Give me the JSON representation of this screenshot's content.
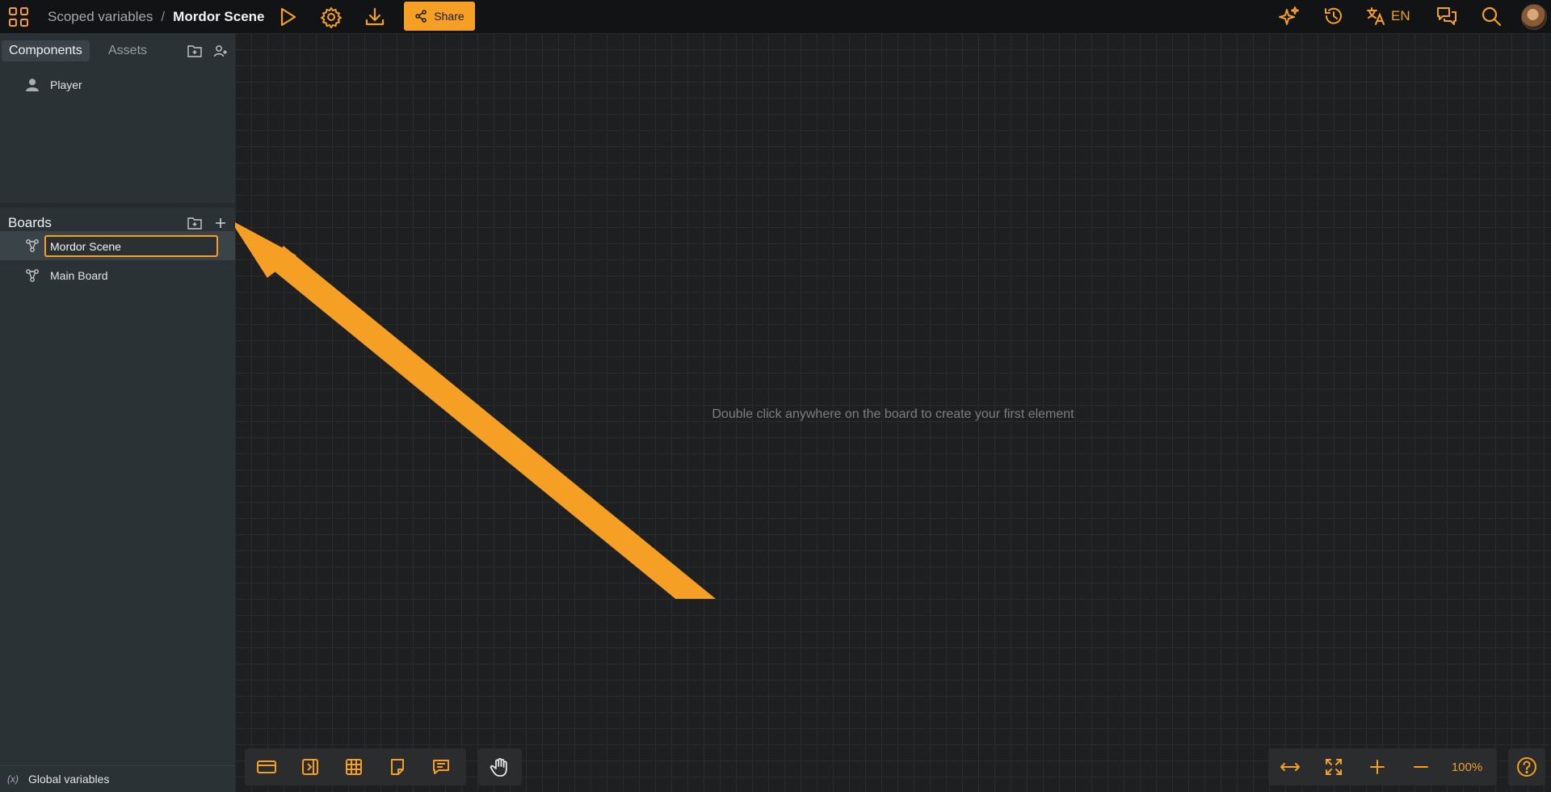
{
  "colors": {
    "accent": "#f5a024",
    "sidebar_bg": "#2b3235",
    "canvas_bg": "#1e1f20",
    "topbar_bg": "#121314"
  },
  "topbar": {
    "project_name": "Scoped variables",
    "separator": "/",
    "current_board": "Mordor Scene",
    "share_label": "Share",
    "language": "EN",
    "icons": [
      "apps-grid-icon",
      "play-icon",
      "gear-icon",
      "download-icon",
      "share-icon",
      "sparkles-icon",
      "history-icon",
      "translate-icon",
      "comments-icon",
      "search-icon",
      "avatar"
    ]
  },
  "sidebar": {
    "tabs": {
      "components": "Components",
      "assets": "Assets"
    },
    "components": [
      {
        "label": "Player",
        "icon": "user-icon"
      }
    ],
    "boards_title": "Boards",
    "boards": [
      {
        "label": "Mordor Scene",
        "icon": "board-graph-icon",
        "editing": true
      },
      {
        "label": "Main Board",
        "icon": "board-graph-icon"
      }
    ],
    "global_variables_icon": "(x)",
    "global_variables_label": "Global variables"
  },
  "canvas": {
    "empty_hint": "Double click anywhere on the board to create your first element",
    "zoom": "100%"
  }
}
